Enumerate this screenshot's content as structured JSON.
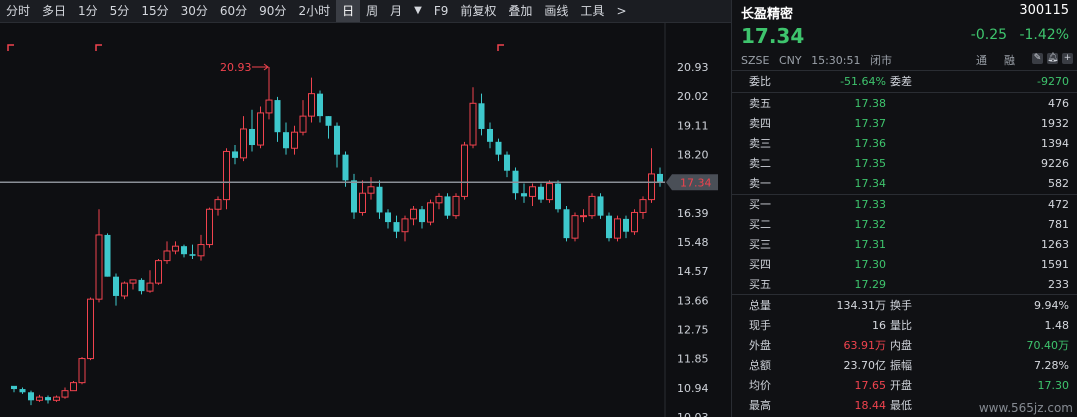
{
  "toolbar": {
    "items": [
      "分时",
      "多日",
      "1分",
      "5分",
      "15分",
      "30分",
      "60分",
      "90分",
      "2小时",
      "日",
      "周",
      "月",
      "▼",
      "F9",
      "前复权",
      "叠加",
      "画线",
      "工具",
      ">"
    ],
    "active_index": 9
  },
  "chart": {
    "price_ticks": [
      "20.93",
      "20.02",
      "19.11",
      "18.20",
      "17.34",
      "16.39",
      "15.48",
      "14.57",
      "13.66",
      "12.75",
      "11.85",
      "10.94",
      "10.03"
    ],
    "current_price_label": "17.34",
    "high_annotation": "20.93",
    "colors": {
      "up": "#f0434e",
      "down": "#3ec8cc",
      "current_line": "#8a8f97",
      "tag_bg": "#4a4f57"
    },
    "candles": [
      [
        11.0,
        10.9,
        10.8,
        10.98
      ],
      [
        10.9,
        10.8,
        10.75,
        10.95
      ],
      [
        10.8,
        10.55,
        10.4,
        10.85
      ],
      [
        10.55,
        10.65,
        10.5,
        10.72
      ],
      [
        10.65,
        10.55,
        10.45,
        10.7
      ],
      [
        10.55,
        10.65,
        10.5,
        10.7
      ],
      [
        10.65,
        10.85,
        10.6,
        10.95
      ],
      [
        10.85,
        11.1,
        10.85,
        11.15
      ],
      [
        11.1,
        11.85,
        11.05,
        11.9
      ],
      [
        11.85,
        13.7,
        11.8,
        13.75
      ],
      [
        13.7,
        15.7,
        13.6,
        16.5
      ],
      [
        15.7,
        14.4,
        14.4,
        15.75
      ],
      [
        14.4,
        13.8,
        13.5,
        14.5
      ],
      [
        13.8,
        14.2,
        13.7,
        14.25
      ],
      [
        14.2,
        14.3,
        14.0,
        14.3
      ],
      [
        14.3,
        13.95,
        13.85,
        14.35
      ],
      [
        13.95,
        14.2,
        13.9,
        14.6
      ],
      [
        14.2,
        14.9,
        14.15,
        14.95
      ],
      [
        14.9,
        15.2,
        14.8,
        15.5
      ],
      [
        15.2,
        15.35,
        15.1,
        15.5
      ],
      [
        15.35,
        15.1,
        15.0,
        15.4
      ],
      [
        15.1,
        15.05,
        14.95,
        15.4
      ],
      [
        15.05,
        15.4,
        14.9,
        15.7
      ],
      [
        15.4,
        16.5,
        15.3,
        16.55
      ],
      [
        16.5,
        16.8,
        16.3,
        16.9
      ],
      [
        16.8,
        18.3,
        16.5,
        18.4
      ],
      [
        18.3,
        18.1,
        17.9,
        18.5
      ],
      [
        18.1,
        19.0,
        18.0,
        19.4
      ],
      [
        19.0,
        18.5,
        18.3,
        19.6
      ],
      [
        18.5,
        19.5,
        18.4,
        19.7
      ],
      [
        19.5,
        19.9,
        19.3,
        20.93
      ],
      [
        19.9,
        18.9,
        18.6,
        20.0
      ],
      [
        18.9,
        18.4,
        18.2,
        19.2
      ],
      [
        18.4,
        18.9,
        18.2,
        19.1
      ],
      [
        18.9,
        19.4,
        18.8,
        19.9
      ],
      [
        19.4,
        20.1,
        19.2,
        20.6
      ],
      [
        20.1,
        19.4,
        19.2,
        20.2
      ],
      [
        19.4,
        19.1,
        18.7,
        19.4
      ],
      [
        19.1,
        18.2,
        17.8,
        19.2
      ],
      [
        18.2,
        17.4,
        17.2,
        18.3
      ],
      [
        17.4,
        16.4,
        16.2,
        17.6
      ],
      [
        16.4,
        17.0,
        16.3,
        17.4
      ],
      [
        17.0,
        17.2,
        16.8,
        17.5
      ],
      [
        17.2,
        16.4,
        16.2,
        17.4
      ],
      [
        16.4,
        16.1,
        15.9,
        16.5
      ],
      [
        16.1,
        15.8,
        15.6,
        16.3
      ],
      [
        15.8,
        16.2,
        15.5,
        16.3
      ],
      [
        16.2,
        16.5,
        16.0,
        16.6
      ],
      [
        16.5,
        16.1,
        15.9,
        16.6
      ],
      [
        16.1,
        16.7,
        16.0,
        16.8
      ],
      [
        16.7,
        16.9,
        16.5,
        17.0
      ],
      [
        16.9,
        16.3,
        16.2,
        17.0
      ],
      [
        16.3,
        16.9,
        16.2,
        17.0
      ],
      [
        16.9,
        18.5,
        16.8,
        18.6
      ],
      [
        18.5,
        19.8,
        18.4,
        20.3
      ],
      [
        19.8,
        19.0,
        18.8,
        20.1
      ],
      [
        19.0,
        18.6,
        18.4,
        19.2
      ],
      [
        18.6,
        18.2,
        18.0,
        18.7
      ],
      [
        18.2,
        17.7,
        17.5,
        18.3
      ],
      [
        17.7,
        17.0,
        16.8,
        17.8
      ],
      [
        17.0,
        16.9,
        16.7,
        17.3
      ],
      [
        16.9,
        17.2,
        16.6,
        17.3
      ],
      [
        17.2,
        16.8,
        16.7,
        17.3
      ],
      [
        16.8,
        17.3,
        16.7,
        17.4
      ],
      [
        17.3,
        16.5,
        16.4,
        17.4
      ],
      [
        16.5,
        15.6,
        15.5,
        16.6
      ],
      [
        15.6,
        16.3,
        15.5,
        16.4
      ],
      [
        16.3,
        16.3,
        16.1,
        16.5
      ],
      [
        16.3,
        16.9,
        16.2,
        17.0
      ],
      [
        16.9,
        16.3,
        16.2,
        17.0
      ],
      [
        16.3,
        15.6,
        15.5,
        16.4
      ],
      [
        15.6,
        16.2,
        15.5,
        16.3
      ],
      [
        16.2,
        15.8,
        15.6,
        16.3
      ],
      [
        15.8,
        16.4,
        15.7,
        16.5
      ],
      [
        16.4,
        16.8,
        16.2,
        16.9
      ],
      [
        16.8,
        17.6,
        16.7,
        18.4
      ],
      [
        17.6,
        17.34,
        17.2,
        17.8
      ]
    ]
  },
  "quote": {
    "name": "长盈精密",
    "code": "300115",
    "price": "17.34",
    "change": "-0.25",
    "change_pct": "-1.42%",
    "market": "SZSE",
    "currency": "CNY",
    "time": "15:30:51",
    "status": "闭市",
    "tong": "通",
    "rong": "融",
    "icons": [
      "pencil-icon",
      "bell-icon",
      "plus-icon"
    ]
  },
  "order_book": {
    "weibi_label": "委比",
    "weibi_value": "-51.64%",
    "weicha_label": "委差",
    "weicha_value": "-9270",
    "asks": [
      {
        "label": "卖五",
        "price": "17.38",
        "vol": "476"
      },
      {
        "label": "卖四",
        "price": "17.37",
        "vol": "1932"
      },
      {
        "label": "卖三",
        "price": "17.36",
        "vol": "1394"
      },
      {
        "label": "卖二",
        "price": "17.35",
        "vol": "9226"
      },
      {
        "label": "卖一",
        "price": "17.34",
        "vol": "582"
      }
    ],
    "bids": [
      {
        "label": "买一",
        "price": "17.33",
        "vol": "472"
      },
      {
        "label": "买二",
        "price": "17.32",
        "vol": "781"
      },
      {
        "label": "买三",
        "price": "17.31",
        "vol": "1263"
      },
      {
        "label": "买四",
        "price": "17.30",
        "vol": "1591"
      },
      {
        "label": "买五",
        "price": "17.29",
        "vol": "233"
      }
    ]
  },
  "stats": [
    {
      "k1": "总量",
      "v1": "134.31万",
      "c1": "",
      "k2": "换手",
      "v2": "9.94%",
      "c2": ""
    },
    {
      "k1": "现手",
      "v1": "16",
      "c1": "",
      "k2": "量比",
      "v2": "1.48",
      "c2": ""
    },
    {
      "k1": "外盘",
      "v1": "63.91万",
      "c1": "red",
      "k2": "内盘",
      "v2": "70.40万",
      "c2": "green"
    },
    {
      "k1": "总额",
      "v1": "23.70亿",
      "c1": "",
      "k2": "振幅",
      "v2": "7.28%",
      "c2": ""
    },
    {
      "k1": "均价",
      "v1": "17.65",
      "c1": "red",
      "k2": "开盘",
      "v2": "17.30",
      "c2": "green"
    },
    {
      "k1": "最高",
      "v1": "18.44",
      "c1": "red",
      "k2": "最低",
      "v2": "",
      "c2": ""
    }
  ],
  "watermark": "www.565jz.com"
}
